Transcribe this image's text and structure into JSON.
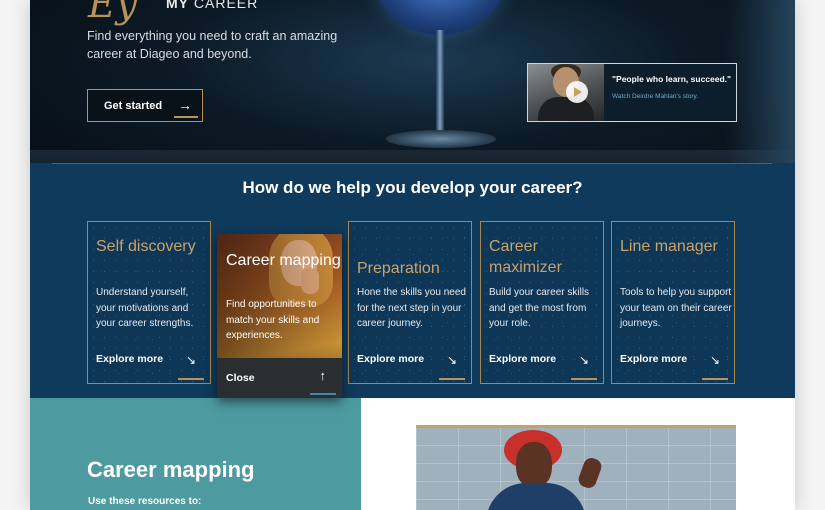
{
  "hero": {
    "script_text": "Ey",
    "title_strong": "MY",
    "title_rest": " CAREER",
    "subtitle": "Find everything you need to craft an amazing career at Diageo and beyond.",
    "cta_label": "Get started",
    "cta_arrow": "→",
    "video": {
      "quote": "\"People who learn, succeed.\"",
      "link": "Watch Deirdre Mahlan's story."
    }
  },
  "help": {
    "title_strong": "How do we help you",
    "title_rest": " develop your career?",
    "cards": [
      {
        "title": "Self discovery",
        "desc": "Understand yourself, your motivations and your career strengths.",
        "explore": "Explore more",
        "arrow": "↘"
      },
      {
        "title": "Career mapping",
        "desc": "Find opportunities to match your skills and experiences.",
        "close": "Close",
        "arrow": "↑"
      },
      {
        "title": "Preparation",
        "desc": "Hone the skills you need for the next step in your career journey.",
        "explore": "Explore more",
        "arrow": "↘"
      },
      {
        "title": "Career maximizer",
        "desc": "Build your career skills and get the most from your role.",
        "explore": "Explore more",
        "arrow": "↘"
      },
      {
        "title": "Line manager",
        "desc": "Tools to help you support your team on their career journeys.",
        "explore": "Explore more",
        "arrow": "↘"
      }
    ]
  },
  "lower": {
    "title": "Career mapping",
    "subtitle": "Use these resources to:"
  },
  "colors": {
    "gold": "#b89256",
    "navy": "#0f3a5b",
    "teal": "#4d9aa1"
  }
}
